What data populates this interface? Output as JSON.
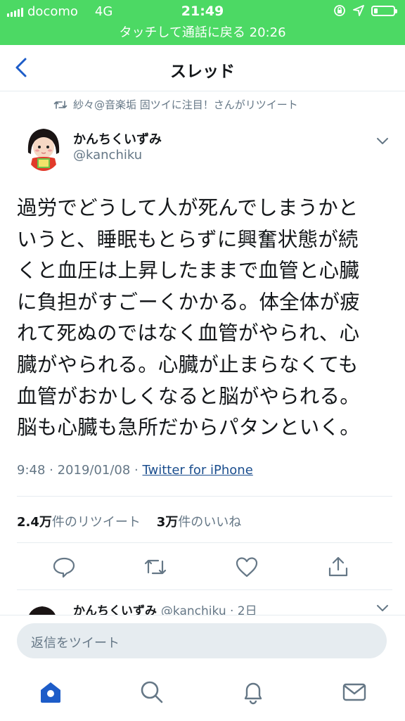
{
  "status_bar": {
    "carrier": "docomo",
    "network": "4G",
    "time": "21:49",
    "call_banner": "タッチして通話に戻る 20:26"
  },
  "nav": {
    "title": "スレッド"
  },
  "tweet": {
    "retweet_context": "紗々@音楽垢 固ツイに注目！さんがリツイート",
    "display_name": "かんちくいずみ",
    "handle": "@kanchiku",
    "lines": [
      "過労でどうして人が死んでしまうかと",
      "いうと、睡眠もとらずに興奮状態が続",
      "くと血圧は上昇したままで血管と心臓",
      "に負担がすごーくかかる。体全体が疲",
      "れて死ぬのではなく血管がやられ、心",
      "臓がやられる。心臓が止まらなくても",
      "血管がおかしくなると脳がやられる。",
      "脳も心臓も急所だからパタンといく。"
    ],
    "timestamp": "9:48 · 2019/01/08 · ",
    "source": "Twitter for iPhone",
    "retweet_count": "2.4万",
    "retweet_label": "件のリツイート",
    "like_count": "3万",
    "like_label": "件のいいね"
  },
  "reply_preview": {
    "display_name": "かんちくいずみ",
    "handle_time": "@kanchiku · 2日"
  },
  "composer": {
    "placeholder": "返信をツイート"
  },
  "colors": {
    "status_green": "#4cd964",
    "accent_blue": "#1da1f2",
    "tab_active": "#1d5cc8",
    "muted": "#657786"
  }
}
